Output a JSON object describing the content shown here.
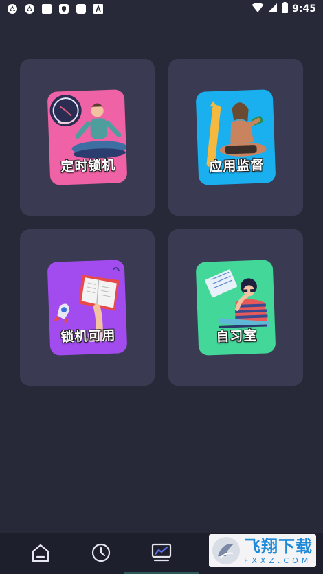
{
  "status_bar": {
    "time": "9:45",
    "left_icons": [
      "app-notification-icon",
      "app-notification-icon",
      "square-notification-icon",
      "shield-notification-icon",
      "square-notification-icon",
      "text-notification-icon"
    ],
    "right_icons": [
      "wifi-icon",
      "signal-icon",
      "battery-icon"
    ]
  },
  "cards": [
    {
      "label": "定时锁机",
      "bg": "#f062a6",
      "icon": "meditation-timer-illustration"
    },
    {
      "label": "应用监督",
      "bg": "#1ab0f0",
      "icon": "phone-user-illustration"
    },
    {
      "label": "锁机可用",
      "bg": "#a24cf0",
      "icon": "rocket-book-illustration"
    },
    {
      "label": "自习室",
      "bg": "#43d89a",
      "icon": "study-room-illustration"
    }
  ],
  "bottom_nav": {
    "items": [
      {
        "name": "home",
        "icon": "home-icon"
      },
      {
        "name": "clock",
        "icon": "clock-icon"
      },
      {
        "name": "stats",
        "icon": "chart-icon",
        "active": true
      }
    ]
  },
  "watermark": {
    "main": "飞翔下载",
    "sub": "FXXZ.COM"
  }
}
